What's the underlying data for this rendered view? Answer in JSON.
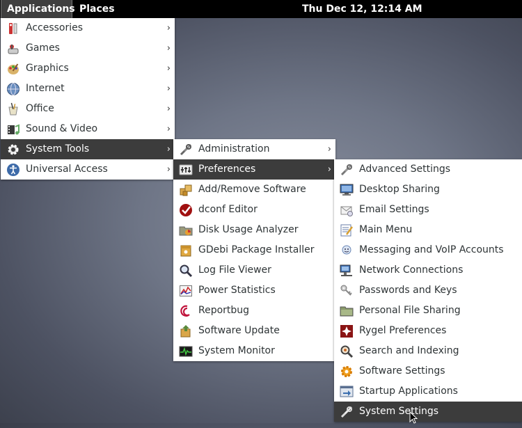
{
  "topbar": {
    "applications": "Applications",
    "places": "Places",
    "clock": "Thu Dec 12, 12:14 AM"
  },
  "menu1": {
    "items": [
      {
        "label": "Accessories",
        "icon": "accessories-icon"
      },
      {
        "label": "Games",
        "icon": "games-icon"
      },
      {
        "label": "Graphics",
        "icon": "graphics-icon"
      },
      {
        "label": "Internet",
        "icon": "internet-icon"
      },
      {
        "label": "Office",
        "icon": "office-icon"
      },
      {
        "label": "Sound & Video",
        "icon": "sound-video-icon"
      },
      {
        "label": "System Tools",
        "icon": "system-tools-icon"
      },
      {
        "label": "Universal Access",
        "icon": "universal-access-icon"
      }
    ]
  },
  "menu2": {
    "items": [
      {
        "label": "Administration",
        "icon": "administration-icon"
      },
      {
        "label": "Preferences",
        "icon": "preferences-icon"
      },
      {
        "label": "Add/Remove Software",
        "icon": "add-remove-software-icon"
      },
      {
        "label": "dconf Editor",
        "icon": "dconf-editor-icon"
      },
      {
        "label": "Disk Usage Analyzer",
        "icon": "disk-usage-icon"
      },
      {
        "label": "GDebi Package Installer",
        "icon": "gdebi-icon"
      },
      {
        "label": "Log File Viewer",
        "icon": "log-viewer-icon"
      },
      {
        "label": "Power Statistics",
        "icon": "power-statistics-icon"
      },
      {
        "label": "Reportbug",
        "icon": "reportbug-icon"
      },
      {
        "label": "Software Update",
        "icon": "software-update-icon"
      },
      {
        "label": "System Monitor",
        "icon": "system-monitor-icon"
      }
    ]
  },
  "menu3": {
    "items": [
      {
        "label": "Advanced Settings",
        "icon": "advanced-settings-icon"
      },
      {
        "label": "Desktop Sharing",
        "icon": "desktop-sharing-icon"
      },
      {
        "label": "Email Settings",
        "icon": "email-settings-icon"
      },
      {
        "label": "Main Menu",
        "icon": "main-menu-icon"
      },
      {
        "label": "Messaging and VoIP Accounts",
        "icon": "messaging-icon"
      },
      {
        "label": "Network Connections",
        "icon": "network-connections-icon"
      },
      {
        "label": "Passwords and Keys",
        "icon": "passwords-keys-icon"
      },
      {
        "label": "Personal File Sharing",
        "icon": "file-sharing-icon"
      },
      {
        "label": "Rygel Preferences",
        "icon": "rygel-icon"
      },
      {
        "label": "Search and Indexing",
        "icon": "search-indexing-icon"
      },
      {
        "label": "Software Settings",
        "icon": "software-settings-icon"
      },
      {
        "label": "Startup Applications",
        "icon": "startup-apps-icon"
      },
      {
        "label": "System Settings",
        "icon": "system-settings-icon"
      }
    ]
  },
  "colors": {
    "topbar_bg": "#000000",
    "menu_bg": "#ffffff",
    "highlight_bg": "#3c3c3c",
    "text": "#2e3436"
  }
}
